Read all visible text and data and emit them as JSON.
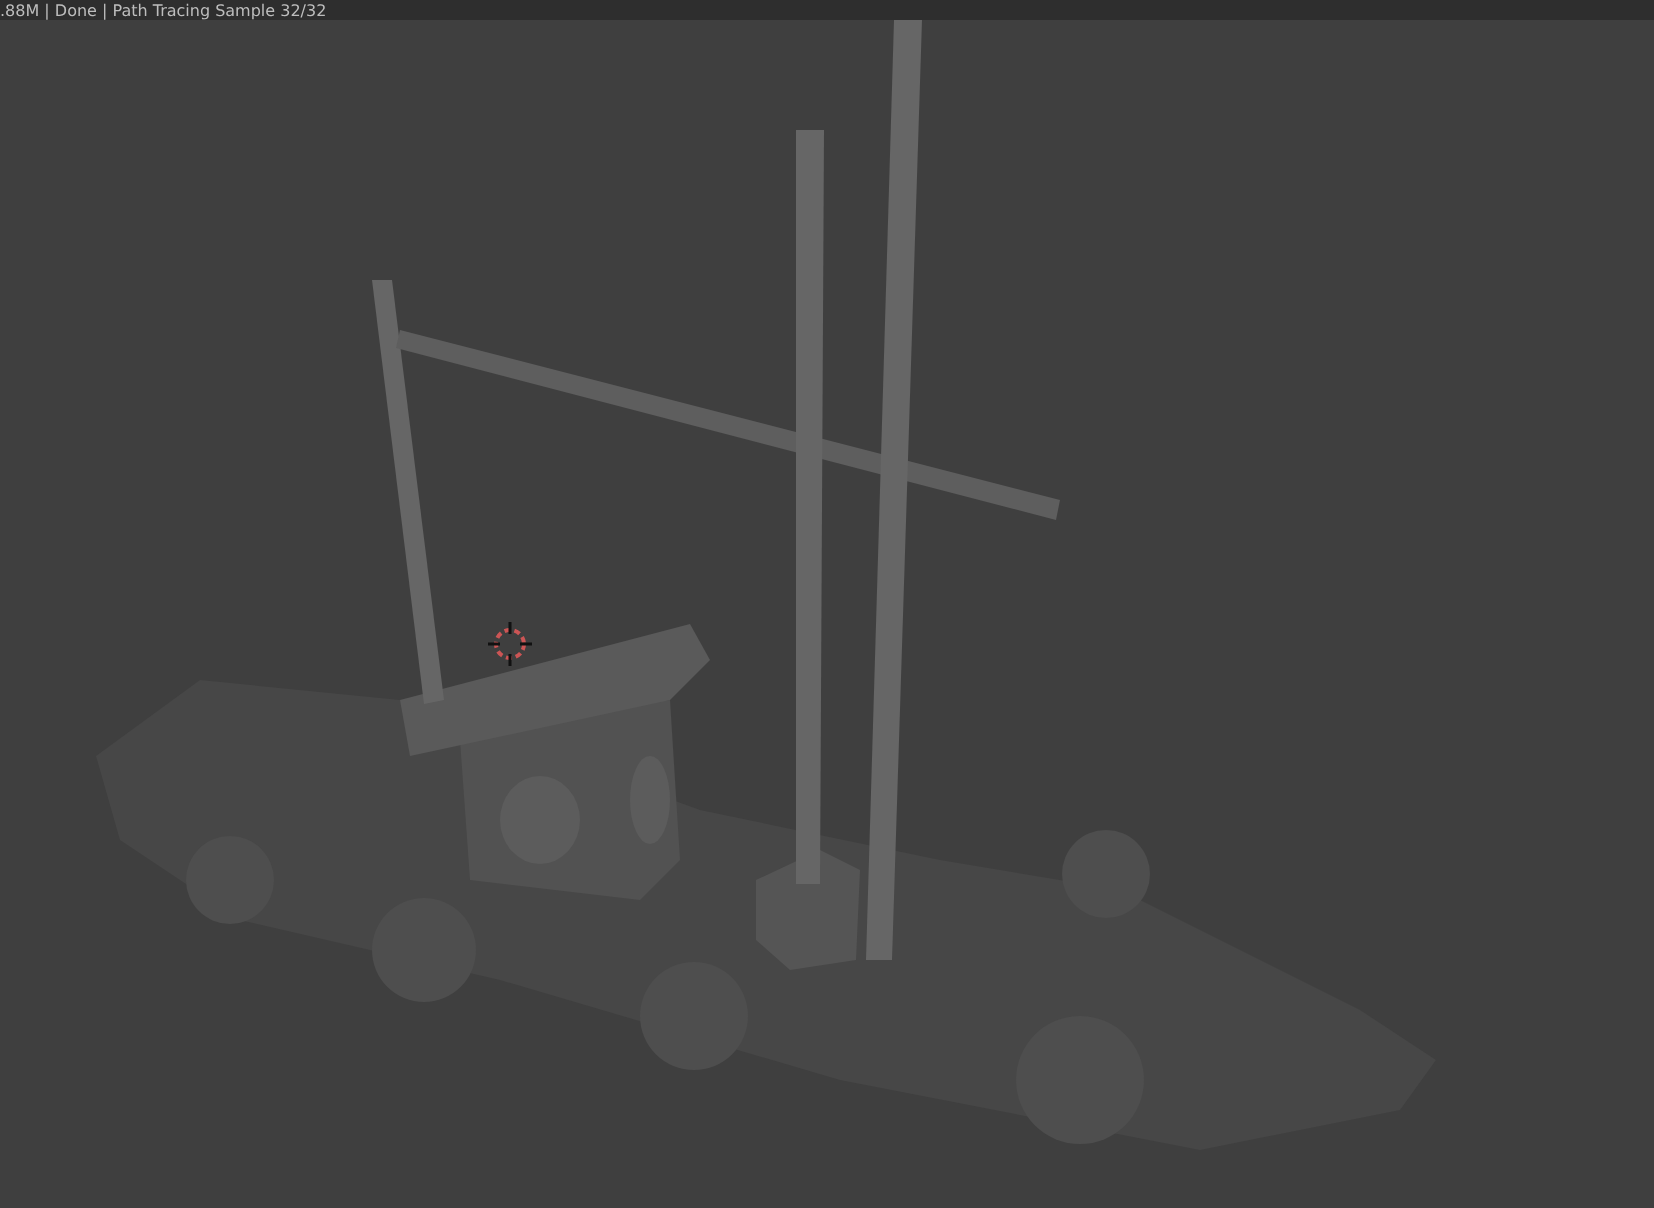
{
  "status_bar": {
    "text": ".88M | Done | Path Tracing Sample 32/32"
  }
}
